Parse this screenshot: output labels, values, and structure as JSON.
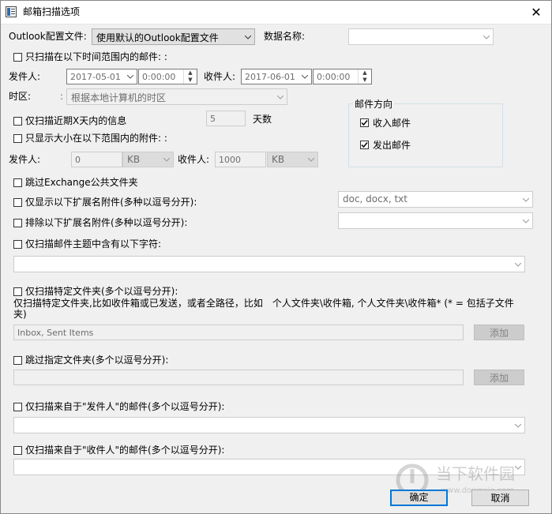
{
  "window": {
    "title": "邮箱扫描选项",
    "close_icon": "close-icon"
  },
  "profile": {
    "label": "Outlook配置文件:",
    "value": "使用默认的Outlook配置文件",
    "db_label": "数据名称:",
    "db_value": ""
  },
  "time_range": {
    "label": "只扫描在以下时间范围内的邮件: :",
    "checked": false,
    "from_label": "发件人:",
    "from_date": "2017-05-01",
    "from_time": "0:00:00",
    "to_label": "收件人:",
    "to_date": "2017-06-01",
    "to_time": "0:00:00"
  },
  "timezone": {
    "label": "时区:",
    "value": "根据本地计算机的时区"
  },
  "direction": {
    "title": "邮件方向",
    "inbox_label": "收入邮件",
    "inbox_checked": true,
    "outbox_label": "发出邮件",
    "outbox_checked": true
  },
  "recent_days": {
    "label": "仅扫描近期X天内的信息",
    "checked": false,
    "value": "5",
    "unit": "天数"
  },
  "attach_size": {
    "label": "只显示大小在以下范围内的附件: :",
    "checked": false,
    "from_label": "发件人:",
    "from_value": "0",
    "from_unit": "KB",
    "to_label": "收件人:",
    "to_value": "1000",
    "to_unit": "KB"
  },
  "skip_exchange": {
    "label": "跳过Exchange公共文件夹",
    "checked": false
  },
  "show_ext": {
    "label": "仅显示以下扩展名附件(多种以逗号分开):",
    "checked": false,
    "value": "doc, docx, txt"
  },
  "exclude_ext": {
    "label": "排除以下扩展名附件(多种以逗号分开):",
    "checked": false,
    "value": ""
  },
  "subject_filter": {
    "label": "仅扫描邮件主题中含有以下字符:",
    "checked": false,
    "value": ""
  },
  "folders": {
    "label": "仅扫描特定文件夹(多个以逗号分开):",
    "checked": false,
    "description": "仅扫描特定文件夹,比如收件箱或已发送，或者全路径，比如　个人文件夹\\收件箱, 个人文件夹\\收件箱* (* = 包括子文件夹)",
    "value": "Inbox, Sent Items",
    "add_label": "添加"
  },
  "skip_folders": {
    "label": "跳过指定文件夹(多个以逗号分开):",
    "checked": false,
    "value": "",
    "add_label": "添加"
  },
  "sender_filter": {
    "label": "仅扫描来自于\"发件人\"的邮件(多个以逗号分开):",
    "checked": false,
    "value": ""
  },
  "recipient_filter": {
    "label": "仅扫描来自于\"收件人\"的邮件(多个以逗号分开):",
    "checked": false,
    "value": ""
  },
  "footer": {
    "ok_label": "确定",
    "cancel_label": "取消"
  },
  "watermark": {
    "text": "当下软件园",
    "url": "www.downxia.com"
  },
  "colors": {
    "accent": "#0078d7",
    "window_bg": "#f0f0f0",
    "disabled_text": "#6d6d6d"
  }
}
